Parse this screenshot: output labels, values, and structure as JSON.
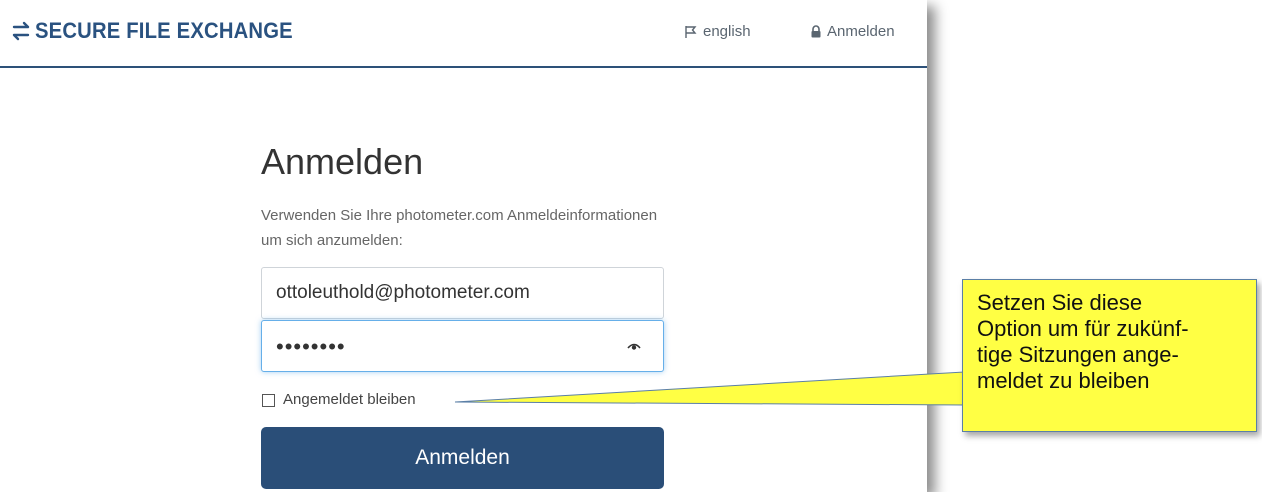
{
  "header": {
    "brand": "SECURE FILE EXCHANGE",
    "brand_icon": "exchange-arrows-icon",
    "language_label": "english",
    "login_label": "Anmelden"
  },
  "login": {
    "title": "Anmelden",
    "subtitle": "Verwenden Sie Ihre photometer.com Anmeldeinformationen um sich anzumelden:",
    "email_value": "ottoleuthold@photometer.com",
    "password_masked": "••••••••",
    "remember_label": "Angemeldet bleiben",
    "submit_label": "Anmelden"
  },
  "callout": {
    "text": "Setzen Sie diese\nOption um für zukünf-\ntige Sitzungen ange-\nmeldet zu bleiben"
  },
  "colors": {
    "brand": "#2a5280",
    "button": "#2a4e78",
    "callout_bg": "#ffff44"
  }
}
